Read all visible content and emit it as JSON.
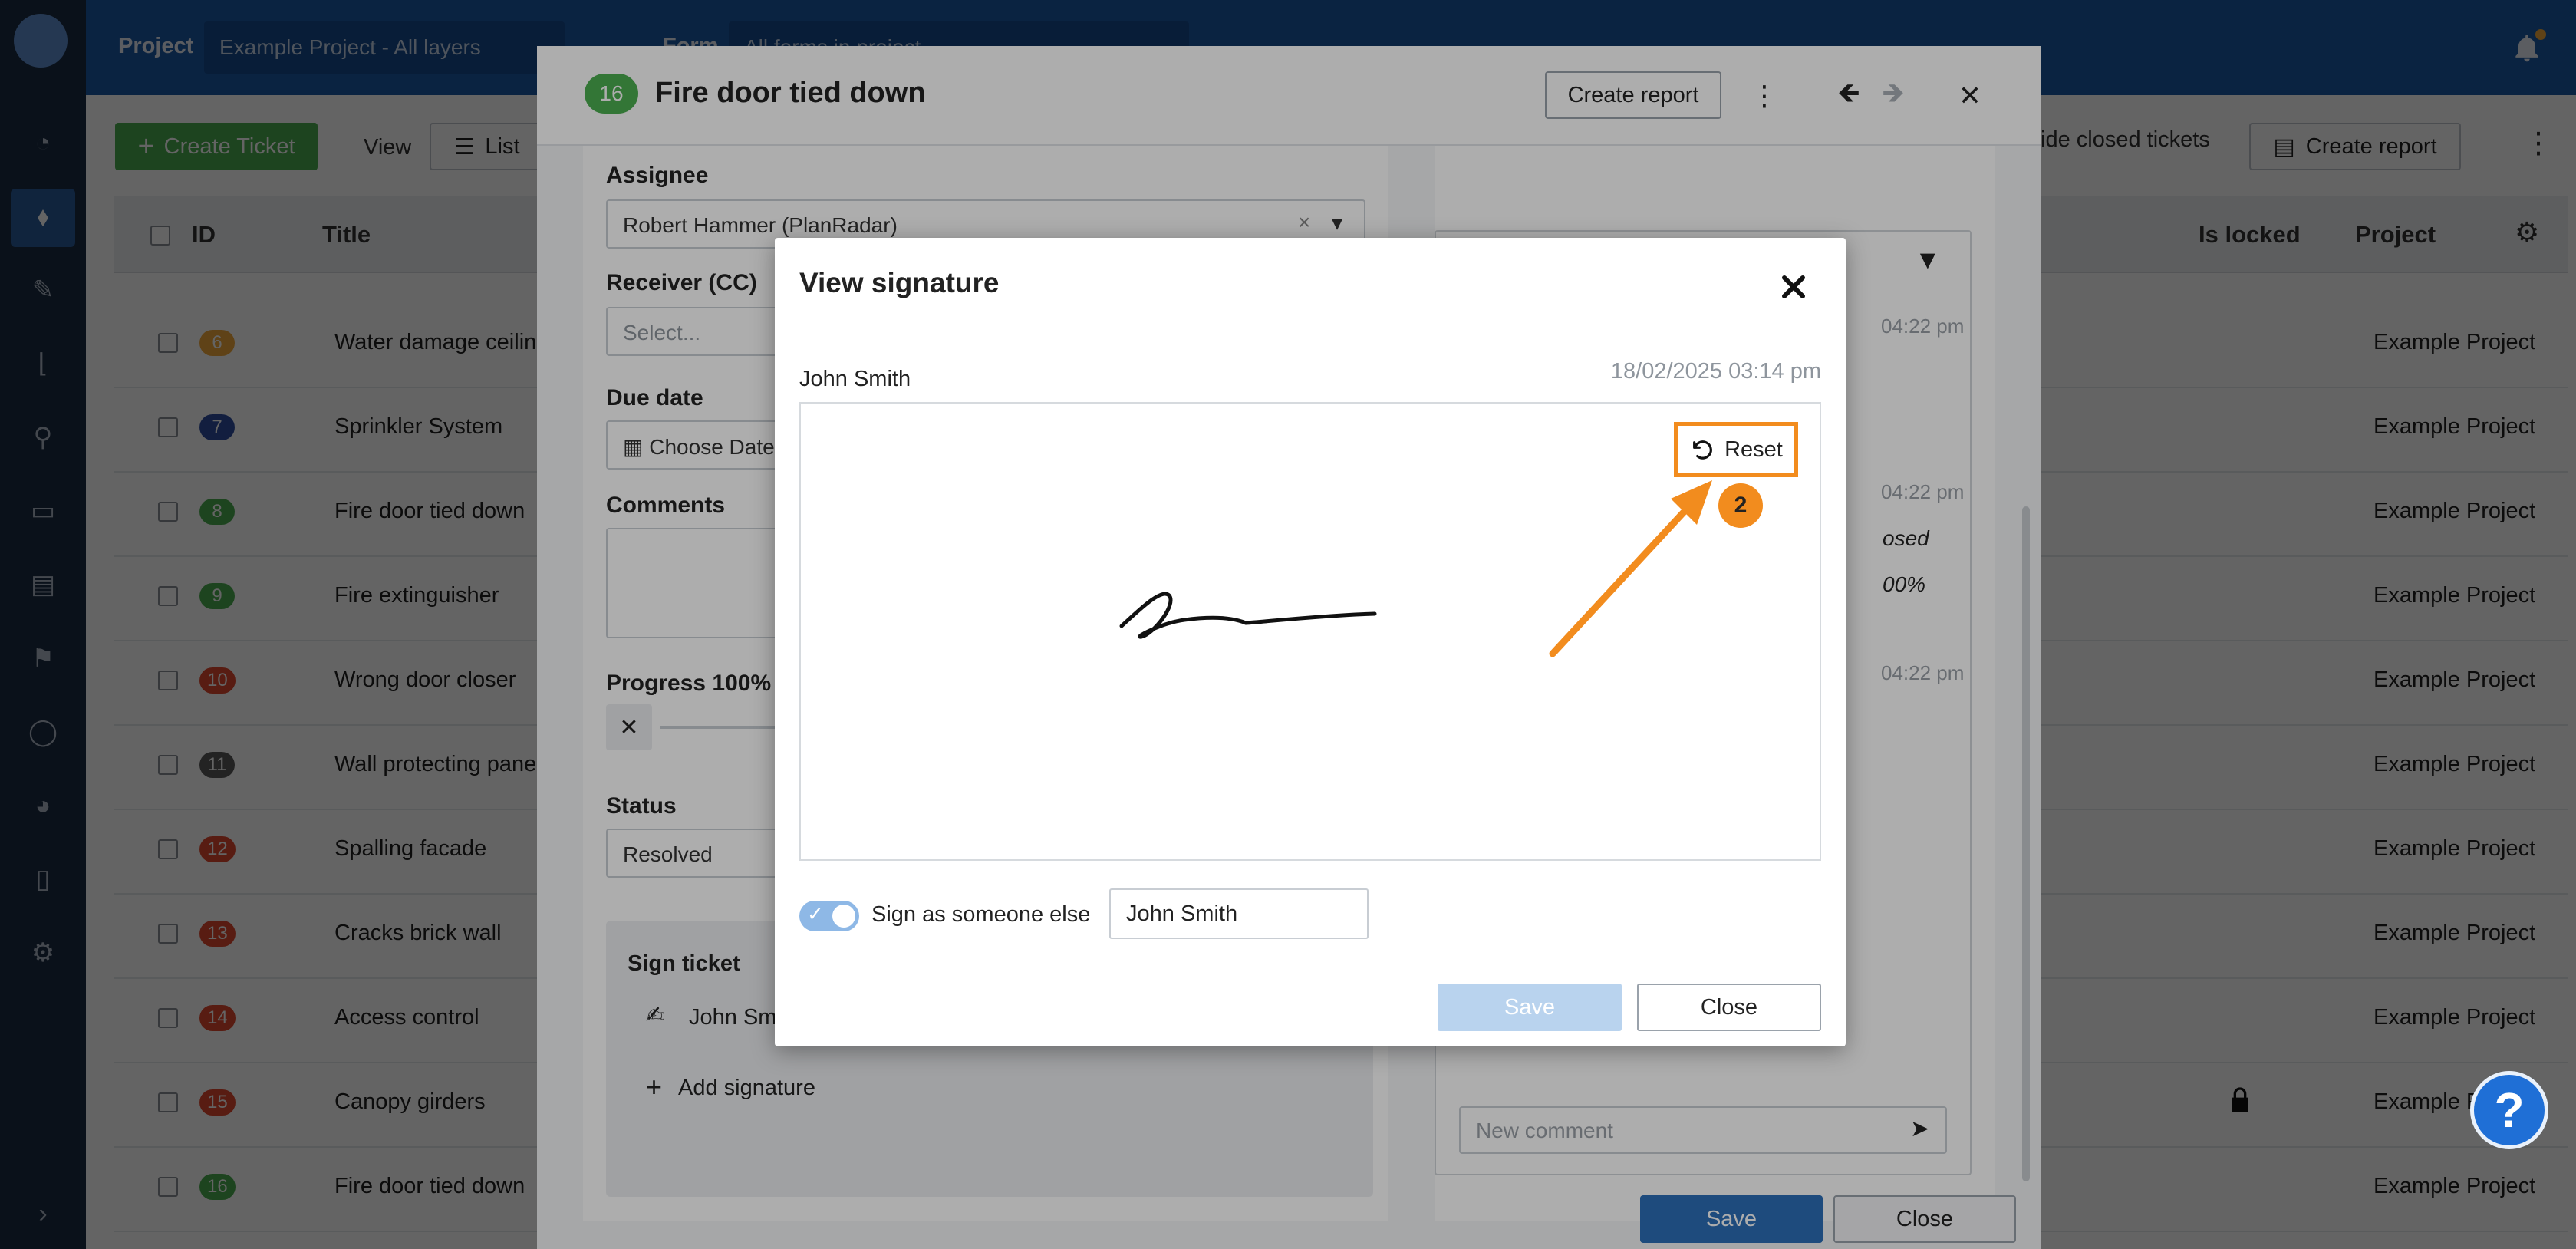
{
  "topbar": {
    "project_label": "Project",
    "project_value": "Example Project - All layers",
    "form_label": "Form",
    "form_value": "All forms in project"
  },
  "toolbar": {
    "create_ticket": "Create Ticket",
    "view_label": "View",
    "list_label": "List",
    "hide_closed": "ide closed tickets",
    "create_report": "Create report"
  },
  "table": {
    "headers": {
      "id": "ID",
      "title": "Title",
      "is_locked": "Is locked",
      "project": "Project"
    },
    "rows": [
      {
        "id": "6",
        "color": "#f2a93b",
        "title": "Water damage ceiling",
        "project": "Example Project",
        "locked": false
      },
      {
        "id": "7",
        "color": "#2f4fa3",
        "title": "Sprinkler System",
        "project": "Example Project",
        "locked": false
      },
      {
        "id": "8",
        "color": "#4caf50",
        "title": "Fire door tied down",
        "project": "Example Project",
        "locked": false
      },
      {
        "id": "9",
        "color": "#4caf50",
        "title": "Fire extinguisher",
        "project": "Example Project",
        "locked": false
      },
      {
        "id": "10",
        "color": "#e0492f",
        "title": "Wrong door closer",
        "project": "Example Project",
        "locked": false
      },
      {
        "id": "11",
        "color": "#5a5a5a",
        "title": "Wall protecting panel",
        "project": "Example Project",
        "locked": false
      },
      {
        "id": "12",
        "color": "#e0492f",
        "title": "Spalling facade",
        "project": "Example Project",
        "locked": false
      },
      {
        "id": "13",
        "color": "#e0492f",
        "title": "Cracks brick wall",
        "project": "Example Project",
        "locked": false
      },
      {
        "id": "14",
        "color": "#e0492f",
        "title": "Access control",
        "project": "Example Project",
        "locked": false
      },
      {
        "id": "15",
        "color": "#e0492f",
        "title": "Canopy girders",
        "project": "Example P",
        "locked": true
      },
      {
        "id": "16",
        "color": "#4caf50",
        "title": "Fire door tied down",
        "project": "Example Project",
        "locked": false
      }
    ]
  },
  "ticket": {
    "number": "16",
    "title": "Fire door tied down",
    "create_report": "Create report",
    "assignee_label": "Assignee",
    "assignee_value": "Robert Hammer (PlanRadar)",
    "receiver_label": "Receiver (CC)",
    "receiver_placeholder": "Select...",
    "due_label": "Due date",
    "due_value": "Choose Date",
    "comments_label": "Comments",
    "progress_label": "Progress 100%",
    "status_label": "Status",
    "status_value": "Resolved",
    "sign_label": "Sign ticket",
    "sign_name": "John Smi",
    "add_signature": "Add signature",
    "times": [
      "04:22 pm",
      "04:22 pm",
      "04:22 pm"
    ],
    "frag_closed": "osed",
    "frag_percent": "00%",
    "new_comment_placeholder": "New comment",
    "save": "Save",
    "close": "Close"
  },
  "dialog": {
    "title": "View signature",
    "signer": "John Smith",
    "date": "18/02/2025 03:14 pm",
    "reset": "Reset",
    "toggle_label": "Sign as someone else",
    "name_value": "John Smith",
    "save": "Save",
    "close": "Close"
  },
  "annotation": {
    "step": "2",
    "color": "#f28c1e"
  },
  "help": {
    "label": "?"
  }
}
